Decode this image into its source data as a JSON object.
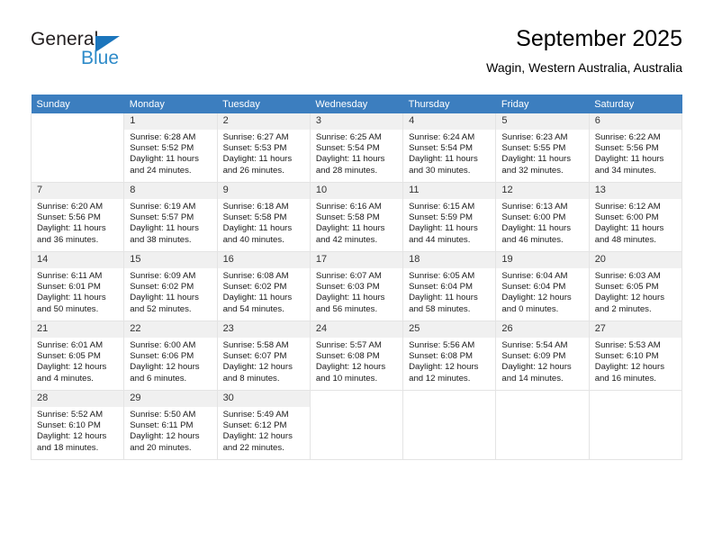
{
  "brand": {
    "name_top": "General",
    "name_bottom": "Blue",
    "accent_color": "#2e8bc9",
    "triangle_color": "#1b75bc"
  },
  "header": {
    "title": "September 2025",
    "subtitle": "Wagin, Western Australia, Australia"
  },
  "calendar": {
    "header_bg": "#3c7ebf",
    "header_text_color": "#ffffff",
    "daynum_bg": "#f0f0f0",
    "weekdays": [
      "Sunday",
      "Monday",
      "Tuesday",
      "Wednesday",
      "Thursday",
      "Friday",
      "Saturday"
    ],
    "labels": {
      "sunrise": "Sunrise:",
      "sunset": "Sunset:",
      "daylight": "Daylight:"
    },
    "weeks": [
      [
        {
          "day": "",
          "sunrise": "",
          "sunset": "",
          "daylight": ""
        },
        {
          "day": "1",
          "sunrise": "Sunrise: 6:28 AM",
          "sunset": "Sunset: 5:52 PM",
          "daylight": "Daylight: 11 hours and 24 minutes."
        },
        {
          "day": "2",
          "sunrise": "Sunrise: 6:27 AM",
          "sunset": "Sunset: 5:53 PM",
          "daylight": "Daylight: 11 hours and 26 minutes."
        },
        {
          "day": "3",
          "sunrise": "Sunrise: 6:25 AM",
          "sunset": "Sunset: 5:54 PM",
          "daylight": "Daylight: 11 hours and 28 minutes."
        },
        {
          "day": "4",
          "sunrise": "Sunrise: 6:24 AM",
          "sunset": "Sunset: 5:54 PM",
          "daylight": "Daylight: 11 hours and 30 minutes."
        },
        {
          "day": "5",
          "sunrise": "Sunrise: 6:23 AM",
          "sunset": "Sunset: 5:55 PM",
          "daylight": "Daylight: 11 hours and 32 minutes."
        },
        {
          "day": "6",
          "sunrise": "Sunrise: 6:22 AM",
          "sunset": "Sunset: 5:56 PM",
          "daylight": "Daylight: 11 hours and 34 minutes."
        }
      ],
      [
        {
          "day": "7",
          "sunrise": "Sunrise: 6:20 AM",
          "sunset": "Sunset: 5:56 PM",
          "daylight": "Daylight: 11 hours and 36 minutes."
        },
        {
          "day": "8",
          "sunrise": "Sunrise: 6:19 AM",
          "sunset": "Sunset: 5:57 PM",
          "daylight": "Daylight: 11 hours and 38 minutes."
        },
        {
          "day": "9",
          "sunrise": "Sunrise: 6:18 AM",
          "sunset": "Sunset: 5:58 PM",
          "daylight": "Daylight: 11 hours and 40 minutes."
        },
        {
          "day": "10",
          "sunrise": "Sunrise: 6:16 AM",
          "sunset": "Sunset: 5:58 PM",
          "daylight": "Daylight: 11 hours and 42 minutes."
        },
        {
          "day": "11",
          "sunrise": "Sunrise: 6:15 AM",
          "sunset": "Sunset: 5:59 PM",
          "daylight": "Daylight: 11 hours and 44 minutes."
        },
        {
          "day": "12",
          "sunrise": "Sunrise: 6:13 AM",
          "sunset": "Sunset: 6:00 PM",
          "daylight": "Daylight: 11 hours and 46 minutes."
        },
        {
          "day": "13",
          "sunrise": "Sunrise: 6:12 AM",
          "sunset": "Sunset: 6:00 PM",
          "daylight": "Daylight: 11 hours and 48 minutes."
        }
      ],
      [
        {
          "day": "14",
          "sunrise": "Sunrise: 6:11 AM",
          "sunset": "Sunset: 6:01 PM",
          "daylight": "Daylight: 11 hours and 50 minutes."
        },
        {
          "day": "15",
          "sunrise": "Sunrise: 6:09 AM",
          "sunset": "Sunset: 6:02 PM",
          "daylight": "Daylight: 11 hours and 52 minutes."
        },
        {
          "day": "16",
          "sunrise": "Sunrise: 6:08 AM",
          "sunset": "Sunset: 6:02 PM",
          "daylight": "Daylight: 11 hours and 54 minutes."
        },
        {
          "day": "17",
          "sunrise": "Sunrise: 6:07 AM",
          "sunset": "Sunset: 6:03 PM",
          "daylight": "Daylight: 11 hours and 56 minutes."
        },
        {
          "day": "18",
          "sunrise": "Sunrise: 6:05 AM",
          "sunset": "Sunset: 6:04 PM",
          "daylight": "Daylight: 11 hours and 58 minutes."
        },
        {
          "day": "19",
          "sunrise": "Sunrise: 6:04 AM",
          "sunset": "Sunset: 6:04 PM",
          "daylight": "Daylight: 12 hours and 0 minutes."
        },
        {
          "day": "20",
          "sunrise": "Sunrise: 6:03 AM",
          "sunset": "Sunset: 6:05 PM",
          "daylight": "Daylight: 12 hours and 2 minutes."
        }
      ],
      [
        {
          "day": "21",
          "sunrise": "Sunrise: 6:01 AM",
          "sunset": "Sunset: 6:05 PM",
          "daylight": "Daylight: 12 hours and 4 minutes."
        },
        {
          "day": "22",
          "sunrise": "Sunrise: 6:00 AM",
          "sunset": "Sunset: 6:06 PM",
          "daylight": "Daylight: 12 hours and 6 minutes."
        },
        {
          "day": "23",
          "sunrise": "Sunrise: 5:58 AM",
          "sunset": "Sunset: 6:07 PM",
          "daylight": "Daylight: 12 hours and 8 minutes."
        },
        {
          "day": "24",
          "sunrise": "Sunrise: 5:57 AM",
          "sunset": "Sunset: 6:08 PM",
          "daylight": "Daylight: 12 hours and 10 minutes."
        },
        {
          "day": "25",
          "sunrise": "Sunrise: 5:56 AM",
          "sunset": "Sunset: 6:08 PM",
          "daylight": "Daylight: 12 hours and 12 minutes."
        },
        {
          "day": "26",
          "sunrise": "Sunrise: 5:54 AM",
          "sunset": "Sunset: 6:09 PM",
          "daylight": "Daylight: 12 hours and 14 minutes."
        },
        {
          "day": "27",
          "sunrise": "Sunrise: 5:53 AM",
          "sunset": "Sunset: 6:10 PM",
          "daylight": "Daylight: 12 hours and 16 minutes."
        }
      ],
      [
        {
          "day": "28",
          "sunrise": "Sunrise: 5:52 AM",
          "sunset": "Sunset: 6:10 PM",
          "daylight": "Daylight: 12 hours and 18 minutes."
        },
        {
          "day": "29",
          "sunrise": "Sunrise: 5:50 AM",
          "sunset": "Sunset: 6:11 PM",
          "daylight": "Daylight: 12 hours and 20 minutes."
        },
        {
          "day": "30",
          "sunrise": "Sunrise: 5:49 AM",
          "sunset": "Sunset: 6:12 PM",
          "daylight": "Daylight: 12 hours and 22 minutes."
        },
        {
          "day": "",
          "sunrise": "",
          "sunset": "",
          "daylight": ""
        },
        {
          "day": "",
          "sunrise": "",
          "sunset": "",
          "daylight": ""
        },
        {
          "day": "",
          "sunrise": "",
          "sunset": "",
          "daylight": ""
        },
        {
          "day": "",
          "sunrise": "",
          "sunset": "",
          "daylight": ""
        }
      ]
    ]
  }
}
